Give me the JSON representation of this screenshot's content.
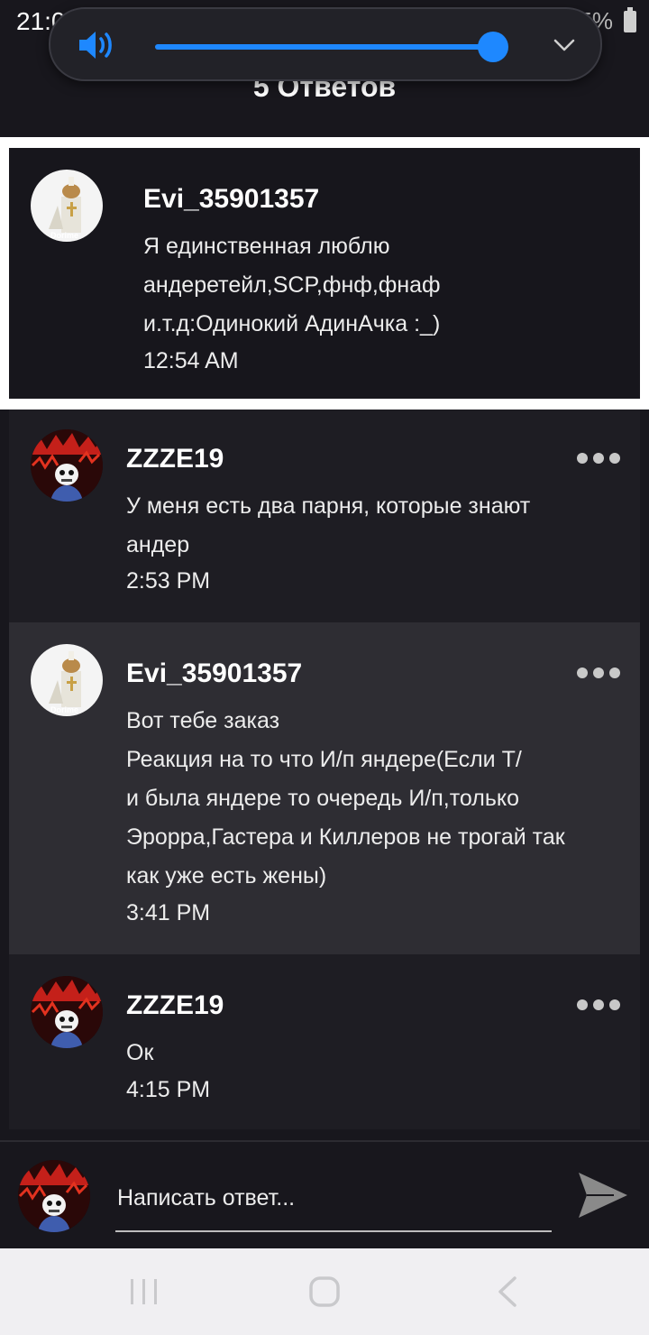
{
  "status_bar": {
    "time": "21:00",
    "battery": "75%"
  },
  "volume_overlay": {
    "level": 1.0,
    "accent_color": "#1e88ff"
  },
  "header": {
    "title": "5 Ответов"
  },
  "original_post": {
    "username": "Evi_35901357",
    "avatar": "hamster-pope-avatar",
    "text": "Я единственная люблю\nандеретейл,SCP,фнф,фнаф\nи.т.д:Одинокий АдинАчка :_)",
    "time": "12:54 AM"
  },
  "replies": [
    {
      "username": "ZZZE19",
      "avatar": "skeleton-red-avatar",
      "text": "У меня есть два парня, которые знают\nандер",
      "time": "2:53 PM"
    },
    {
      "username": "Evi_35901357",
      "avatar": "hamster-pope-avatar",
      "text": "Вот тебе заказ\nРеакция на то что И/п яндере(Если Т/\nи была яндере то очередь И/п,только\nЭрорра,Гастера и Киллеров не трогай так\nкак уже есть жены)",
      "time": "3:41 PM"
    },
    {
      "username": "ZZZE19",
      "avatar": "skeleton-red-avatar",
      "text": "Ок",
      "time": "4:15 PM"
    }
  ],
  "reply_bar": {
    "placeholder": "Написать ответ..."
  },
  "nav_bar": {
    "buttons": [
      "recent-apps",
      "home",
      "back"
    ]
  }
}
